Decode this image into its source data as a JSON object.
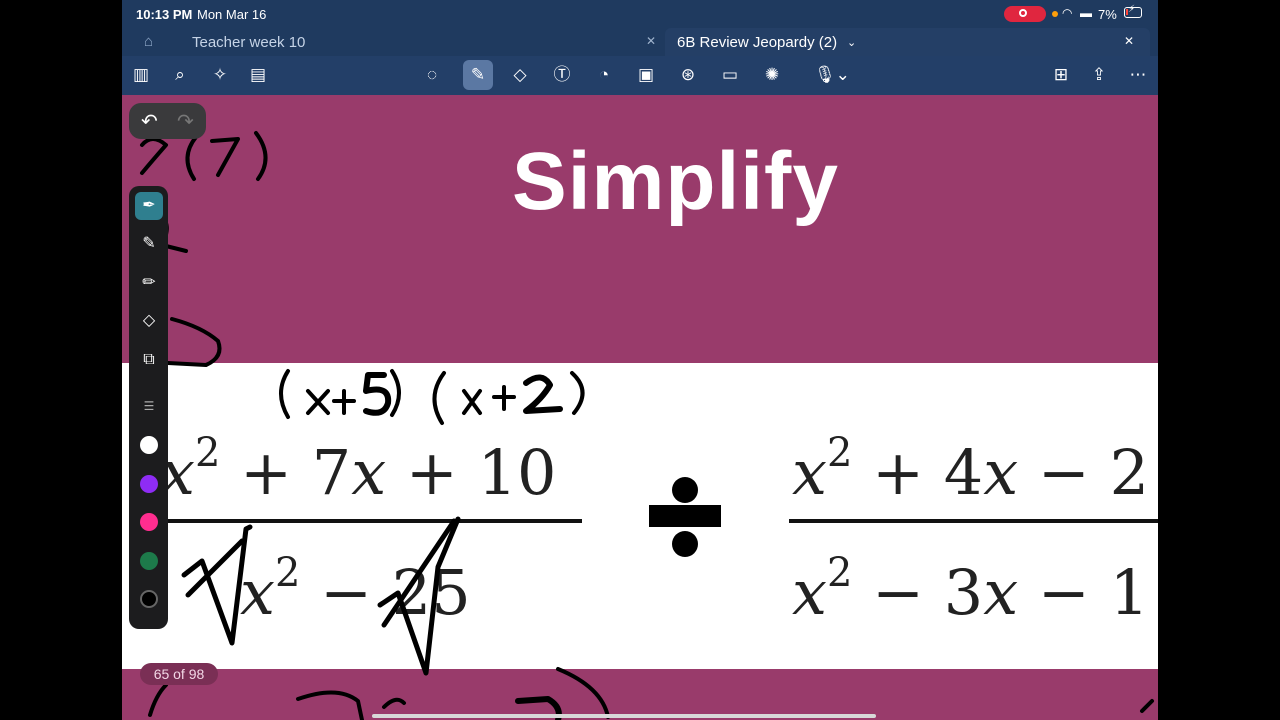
{
  "status_bar": {
    "time": "10:13 PM",
    "date": "Mon Mar 16",
    "battery": "7%"
  },
  "tabs": [
    {
      "label": "Teacher week 10",
      "active": false
    },
    {
      "label": "6B Review Jeopardy (2)",
      "active": true
    }
  ],
  "toolbar": {
    "left_icons": [
      "sidebar-icon",
      "search-icon",
      "sparkle-icon",
      "document-icon"
    ],
    "center_icons": [
      "lasso-icon",
      "pen-icon",
      "eraser-icon",
      "text-box-icon",
      "shapes-icon",
      "image-icon",
      "elements-icon",
      "sticky-note-icon",
      "laser-pointer-icon",
      "microphone-icon"
    ],
    "right_icons": [
      "add-page-icon",
      "share-icon",
      "more-icon"
    ],
    "selected_tool": "pen-icon"
  },
  "slide": {
    "title": "Simplify",
    "left_fraction": {
      "numerator": [
        "x",
        "2",
        " + 7",
        "x",
        " + 10"
      ],
      "denominator": [
        "x",
        "2",
        " − 25"
      ]
    },
    "right_fraction": {
      "numerator": [
        "x",
        "2",
        " + 4",
        "x",
        " − 2"
      ],
      "denominator": [
        "x",
        "2",
        " − 3",
        "x",
        " − 1"
      ]
    },
    "ink_text": [
      "(x+5)(x+2)",
      "5(7)"
    ]
  },
  "pen_palette": {
    "tools": [
      "fountain-pen-icon",
      "highlighter-icon",
      "pencil-icon",
      "eraser-icon",
      "shapes-icon"
    ],
    "colors": [
      "#ffffff",
      "#8e2cf5",
      "#ff2d8f",
      "#1d7a4a",
      "#000000"
    ]
  },
  "page_indicator": "65 of 98"
}
